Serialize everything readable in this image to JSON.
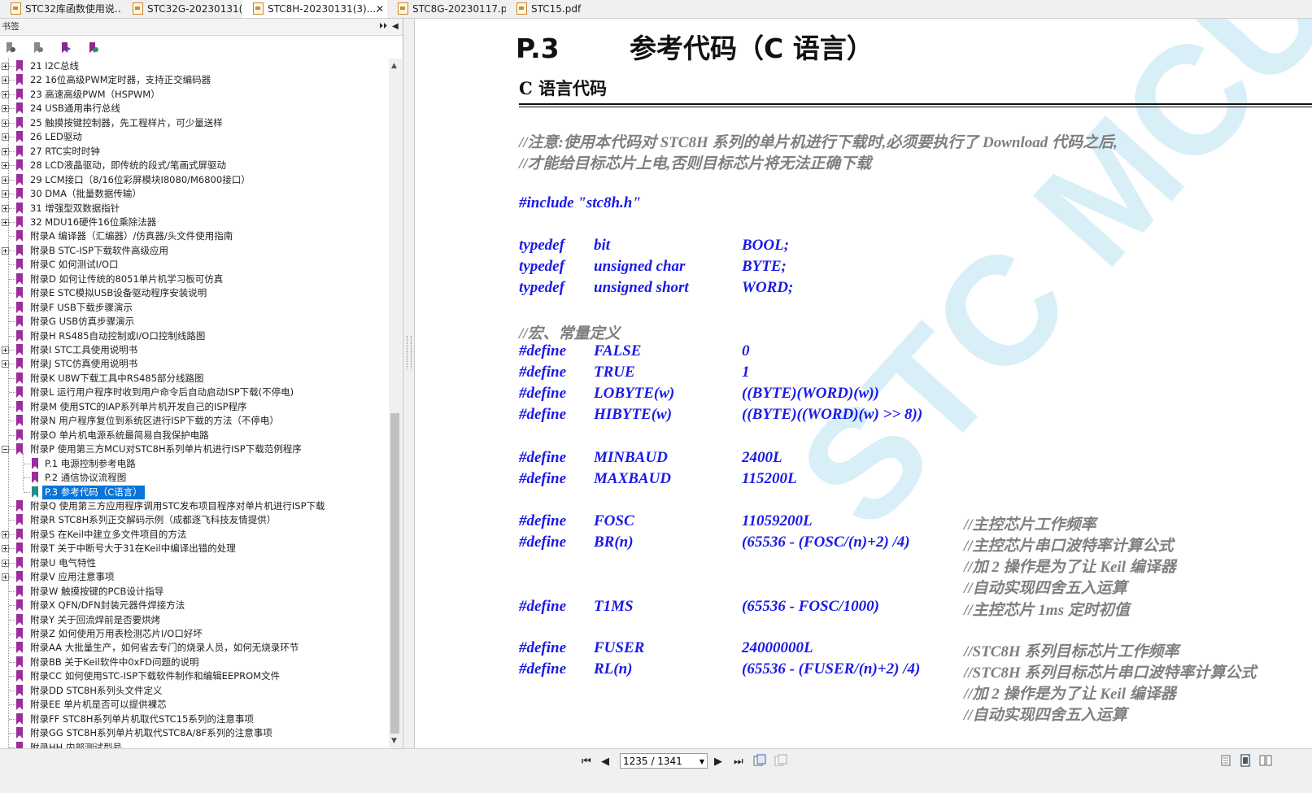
{
  "tabs": [
    {
      "label": "STC32库函数使用说..."
    },
    {
      "label": "STC32G-20230131(..."
    },
    {
      "label": "STC8H-20230131(3)...."
    },
    {
      "label": "STC8G-20230117.p..."
    },
    {
      "label": "STC15.pdf"
    }
  ],
  "sidebar": {
    "title": "书签",
    "items": [
      "21 I2C总线",
      "22 16位高级PWM定时器，支持正交编码器",
      "23 高速高级PWM（HSPWM）",
      "24 USB通用串行总线",
      "25 触摸按键控制器，先工程样片，可少量送样",
      "26 LED驱动",
      "27 RTC实时时钟",
      "28 LCD液晶驱动，即传统的段式/笔画式屏驱动",
      "29 LCM接口（8/16位彩屏模块I8080/M6800接口）",
      "30 DMA（批量数据传输）",
      "31 增强型双数据指针",
      "32 MDU16硬件16位乘除法器",
      "附录A 编译器（汇编器）/仿真器/头文件使用指南",
      "附录B STC-ISP下载软件高级应用",
      "附录C 如何测试I/O口",
      "附录D 如何让传统的8051单片机学习板可仿真",
      "附录E STC模拟USB设备驱动程序安装说明",
      "附录F USB下载步骤演示",
      "附录G USB仿真步骤演示",
      "附录H RS485自动控制或I/O口控制线路图",
      "附录I STC工具使用说明书",
      "附录J STC仿真使用说明书",
      "附录K U8W下载工具中RS485部分线路图",
      "附录L 运行用户程序时收到用户命令后自动启动ISP下载(不停电)",
      "附录M 使用STC的IAP系列单片机开发自己的ISP程序",
      "附录N 用户程序复位到系统区进行ISP下载的方法（不停电）",
      "附录O 单片机电源系统最简易自我保护电路",
      "附录P 使用第三方MCU对STC8H系列单片机进行ISP下载范例程序",
      "P.1 电源控制参考电路",
      "P.2 通信协议流程图",
      "P.3 参考代码（C语言）",
      "附录Q 使用第三方应用程序调用STC发布项目程序对单片机进行ISP下载",
      "附录R STC8H系列正交解码示例（成都逐飞科技友情提供）",
      "附录S 在Keil中建立多文件项目的方法",
      "附录T 关于中断号大于31在Keil中编译出错的处理",
      "附录U 电气特性",
      "附录V 应用注意事项",
      "附录W 触摸按键的PCB设计指导",
      "附录X QFN/DFN封装元器件焊接方法",
      "附录Y 关于回流焊前是否要烘烤",
      "附录Z 如何使用万用表检测芯片I/O口好坏",
      "附录AA 大批量生产，如何省去专门的烧录人员，如何无烧录环节",
      "附录BB 关于Keil软件中0xFD问题的说明",
      "附录CC 如何使用STC-ISP下载软件制作和编辑EEPROM文件",
      "附录DD STC8H系列头文件定义",
      "附录EE 单片机是否可以提供裸芯",
      "附录FF STC8H系列单片机取代STC15系列的注意事项",
      "附录GG STC8H系列单片机取代STC8A/8F系列的注意事项",
      "附录HH 内部测试型号"
    ]
  },
  "document": {
    "section_number": "P.3",
    "section_title": "参考代码（C 语言）",
    "subheading": "C 语言代码",
    "comment1": "//注意:使用本代码对 STC8H 系列的单片机进行下载时,必须要执行了 Download 代码之后,",
    "comment2": "//才能给目标芯片上电,否则目标芯片将无法正确下载",
    "include": "#include \"stc8h.h\"",
    "typedefs": [
      [
        "typedef",
        "bit",
        "BOOL;"
      ],
      [
        "typedef",
        "unsigned char",
        "BYTE;"
      ],
      [
        "typedef",
        "unsigned short",
        "WORD;"
      ]
    ],
    "macro_comment": "//宏、常量定义",
    "defines": [
      [
        "#define",
        "FALSE",
        "0",
        ""
      ],
      [
        "#define",
        "TRUE",
        "1",
        ""
      ],
      [
        "#define",
        "LOBYTE(w)",
        "((BYTE)(WORD)(w))",
        ""
      ],
      [
        "#define",
        "HIBYTE(w)",
        "((BYTE)((WORD)(w) >> 8))",
        ""
      ],
      [
        "#define",
        "MINBAUD",
        "2400L",
        ""
      ],
      [
        "#define",
        "MAXBAUD",
        "115200L",
        ""
      ],
      [
        "#define",
        "FOSC",
        "11059200L",
        "//主控芯片工作频率"
      ],
      [
        "#define",
        "BR(n)",
        "(65536 - (FOSC/(n)+2) /4)",
        "//主控芯片串口波特率计算公式"
      ],
      [
        "",
        "",
        "",
        "//加 2 操作是为了让 Keil 编译器"
      ],
      [
        "",
        "",
        "",
        "//自动实现四舍五入运算"
      ],
      [
        "#define",
        "T1MS",
        "(65536 - FOSC/1000)",
        "//主控芯片 1ms 定时初值"
      ],
      [
        "#define",
        "FUSER",
        "24000000L",
        "//STC8H 系列目标芯片工作频率"
      ],
      [
        "#define",
        "RL(n)",
        "(65536 - (FUSER/(n)+2) /4)",
        "//STC8H 系列目标芯片串口波特率计算公式"
      ],
      [
        "",
        "",
        "",
        "//加 2 操作是为了让 Keil 编译器"
      ],
      [
        "",
        "",
        "",
        "//自动实现四舍五入运算"
      ]
    ],
    "watermark": "STC MCU"
  },
  "status": {
    "page_indicator": "1235 / 1341"
  },
  "colors": {
    "code_blue": "#1a1ae6",
    "comment_gray": "#7f7f7f",
    "selection": "#0a74d8",
    "bookmark": "#9a2e9a"
  }
}
